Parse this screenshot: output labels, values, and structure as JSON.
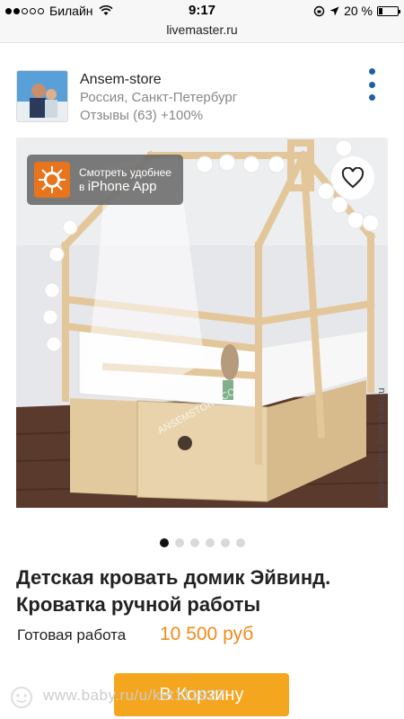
{
  "status_bar": {
    "carrier": "Билайн",
    "time": "9:17",
    "battery": "20 %",
    "battery_level": 0.2
  },
  "browser": {
    "url": "livemaster.ru"
  },
  "seller": {
    "name": "Ansem-store",
    "location": "Россия, Санкт-Петербург",
    "reviews": "Отзывы (63) +100%"
  },
  "banner": {
    "line1": "Смотреть удобнее",
    "line2_prefix": "в",
    "line2_app": "iPhone App"
  },
  "photo": {
    "watermark_main": "ANSEMSTORE.COM",
    "watermark_side": "ansem-store.livemaster.ru"
  },
  "pager": {
    "count": 6,
    "active": 0
  },
  "product": {
    "title": "Детская кровать домик Эйвинд. Кроватка ручной работы",
    "status_label": "Готовая работа",
    "price": "10 500 руб"
  },
  "cart_button": {
    "label": "В Корзину"
  },
  "page_watermark": "www.baby.ru/u/ket111927",
  "colors": {
    "accent": "#f28a1a",
    "cart_button": "#f4a61e",
    "menu_dots": "#1f5fa6"
  },
  "icons": [
    "wifi-icon",
    "location-arrow-icon",
    "heart-icon",
    "app-logo-icon",
    "more-vertical-icon"
  ]
}
